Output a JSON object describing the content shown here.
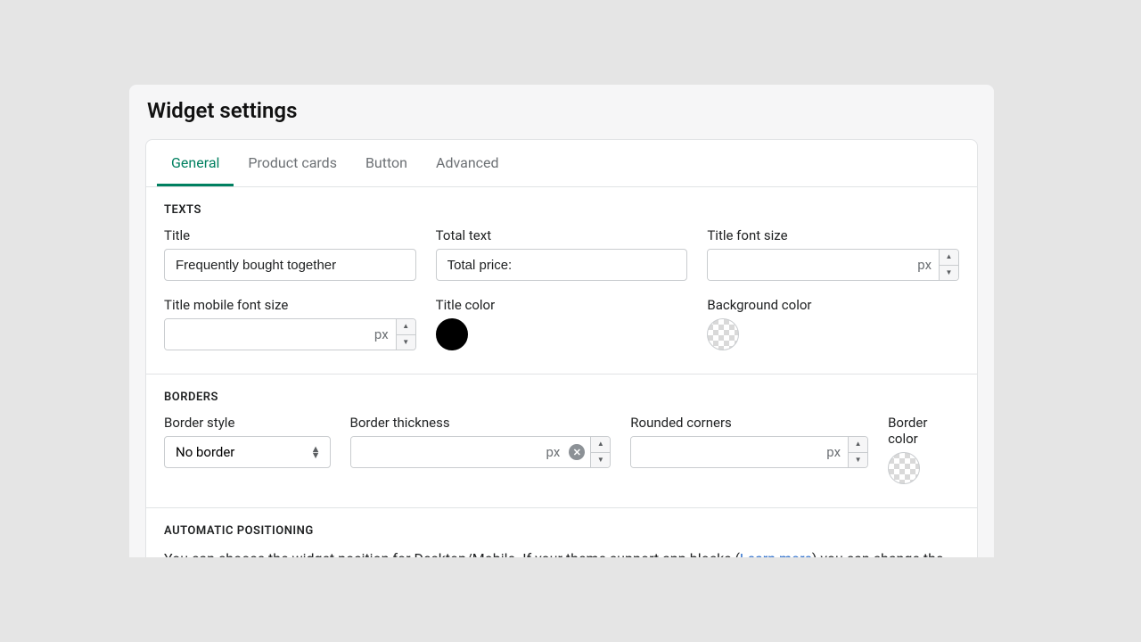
{
  "page_title": "Widget settings",
  "tabs": [
    "General",
    "Product cards",
    "Button",
    "Advanced"
  ],
  "active_tab": 0,
  "sections": {
    "texts": {
      "heading": "TEXTS",
      "title_label": "Title",
      "title_value": "Frequently bought together",
      "total_text_label": "Total text",
      "total_text_value": "Total price:",
      "title_font_size_label": "Title font size",
      "title_font_size_unit": "px",
      "title_mobile_font_size_label": "Title mobile font size",
      "title_mobile_font_size_unit": "px",
      "title_color_label": "Title color",
      "title_color_value": "#000000",
      "background_color_label": "Background color",
      "background_color_value": "transparent"
    },
    "borders": {
      "heading": "BORDERS",
      "border_style_label": "Border style",
      "border_style_value": "No border",
      "border_thickness_label": "Border thickness",
      "border_thickness_unit": "px",
      "rounded_corners_label": "Rounded corners",
      "rounded_corners_unit": "px",
      "border_color_label": "Border color",
      "border_color_value": "transparent"
    },
    "positioning": {
      "heading": "AUTOMATIC POSITIONING",
      "desc_pre": "You can choose the widget position for Desktop/Mobile. If your theme support app blocks (",
      "desc_link": "Learn more",
      "desc_post": ") you can change the position from your theme customization page."
    }
  }
}
